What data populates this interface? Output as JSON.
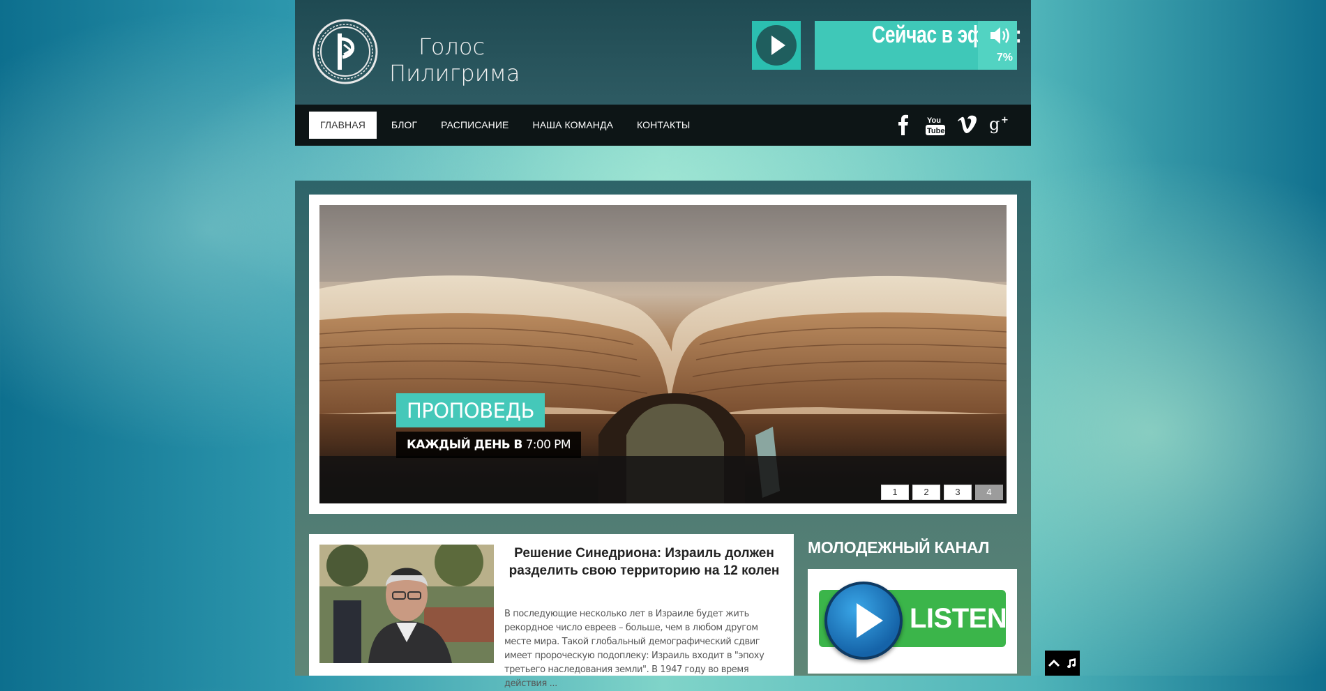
{
  "site": {
    "logo_line1": "Голос",
    "logo_line2": "Пилигрима"
  },
  "player": {
    "onair_label": "Сейчас в эфире:",
    "volume": "7%",
    "play_icon": "play-icon",
    "volume_icon": "speaker-icon"
  },
  "nav": {
    "items": [
      {
        "label": "ГЛАВНАЯ"
      },
      {
        "label": "БЛОГ"
      },
      {
        "label": "РАСПИСАНИЕ"
      },
      {
        "label": "НАША КОМАНДА"
      },
      {
        "label": "КОНТАКТЫ"
      }
    ],
    "active_index": 0,
    "socials": [
      "facebook-icon",
      "youtube-icon",
      "vimeo-icon",
      "google-plus-icon"
    ]
  },
  "slider": {
    "caption_title": "ПРОПОВЕДЬ",
    "caption_sub_bold": "КАЖДЫЙ ДЕНЬ В",
    "caption_sub_time": "7:00 PM",
    "pages": [
      "1",
      "2",
      "3",
      "4"
    ],
    "active_page": 4
  },
  "post": {
    "title": "Решение Синедриона: Израиль должен разделить свою территорию на 12 колен",
    "excerpt": "В последующие несколько лет в Израиле будет жить рекордное число евреев – больше, чем в любом другом месте мира. Такой глобальный демографический сдвиг имеет пророческую подоплеку: Израиль входит в \"эпоху третьего наследования земли\". В 1947 году во время действия ..."
  },
  "sidebar": {
    "title": "МОЛОДЕЖНЫЙ КАНАЛ",
    "listen_label": "LISTEN"
  },
  "colors": {
    "accent": "#45c8b9",
    "header": "#2e5b63",
    "nav": "#0d1516"
  }
}
